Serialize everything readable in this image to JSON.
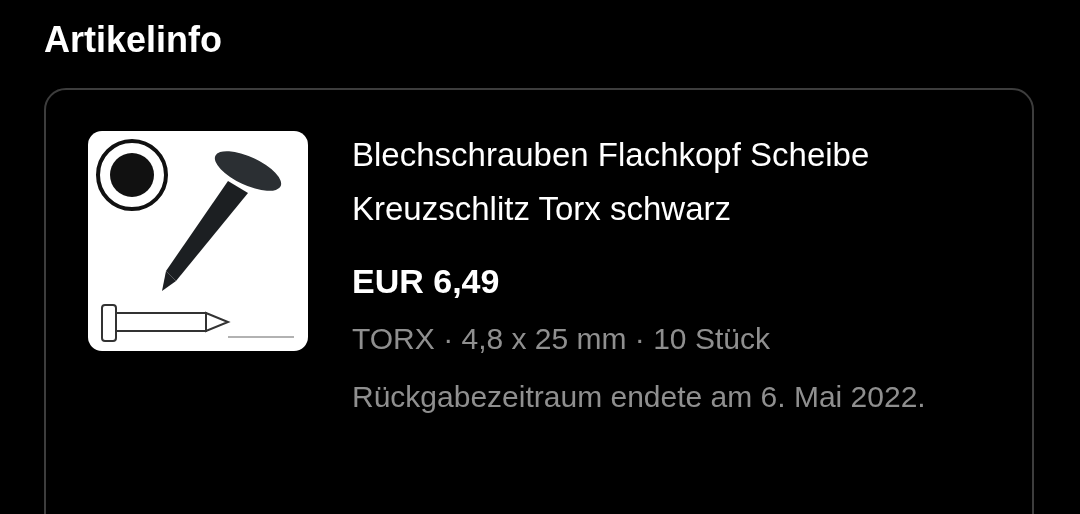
{
  "section_title": "Artikelinfo",
  "item": {
    "title": "Blechschrauben Flachkopf Scheibe Kreuzschlitz Torx schwarz",
    "price": "EUR 6,49",
    "variant": "TORX · 4,8 x 25 mm · 10 Stück",
    "return_note": "Rückgabezeitraum endete am 6. Mai 2022."
  }
}
